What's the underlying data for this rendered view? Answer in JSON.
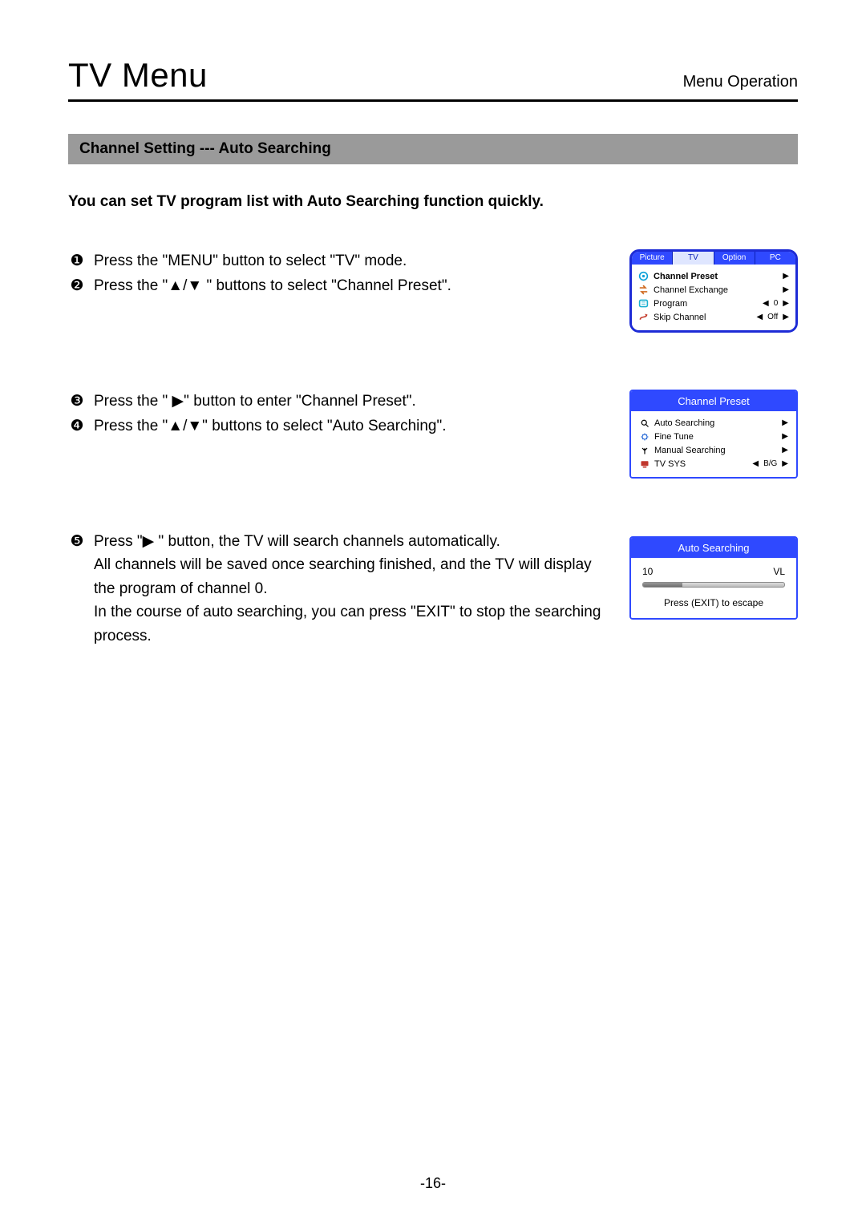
{
  "header": {
    "title": "TV Menu",
    "subtitle": "Menu Operation"
  },
  "section_title": "Channel Setting --- Auto Searching",
  "intro": "You can set TV program list with Auto Searching function quickly.",
  "steps": {
    "s1": "Press the \"MENU\" button to select \"TV\" mode.",
    "s2": "Press the \"▲/▼ \" buttons to select \"Channel Preset\".",
    "s3": "Press the \" ▶\" button to enter \"Channel Preset\".",
    "s4": "Press the \"▲/▼\" buttons to select \"Auto Searching\".",
    "s5a": "Press \"▶ \" button, the TV will search channels automatically.",
    "s5b": "All channels will be saved once searching finished, and the TV will display the program of channel 0.",
    "s5c": "In the course of auto searching, you can press \"EXIT\" to stop the searching process."
  },
  "bullets": {
    "n1": "❶",
    "n2": "❷",
    "n3": "❸",
    "n4": "❹",
    "n5": "❺"
  },
  "tv_menu": {
    "tabs": {
      "picture": "Picture",
      "tv": "TV",
      "option": "Option",
      "pc": "PC"
    },
    "items": {
      "channel_preset": "Channel Preset",
      "channel_exchange": "Channel Exchange",
      "program": "Program",
      "program_value": "0",
      "skip_channel": "Skip Channel",
      "skip_value": "Off"
    }
  },
  "channel_preset": {
    "title": "Channel Preset",
    "items": {
      "auto_searching": "Auto Searching",
      "fine_tune": "Fine Tune",
      "manual_searching": "Manual Searching",
      "tv_sys": "TV SYS",
      "tv_sys_value": "B/G"
    }
  },
  "auto_searching": {
    "title": "Auto Searching",
    "left_value": "10",
    "right_value": "VL",
    "exit_text": "Press (EXIT) to escape"
  },
  "page_number": "-16-"
}
